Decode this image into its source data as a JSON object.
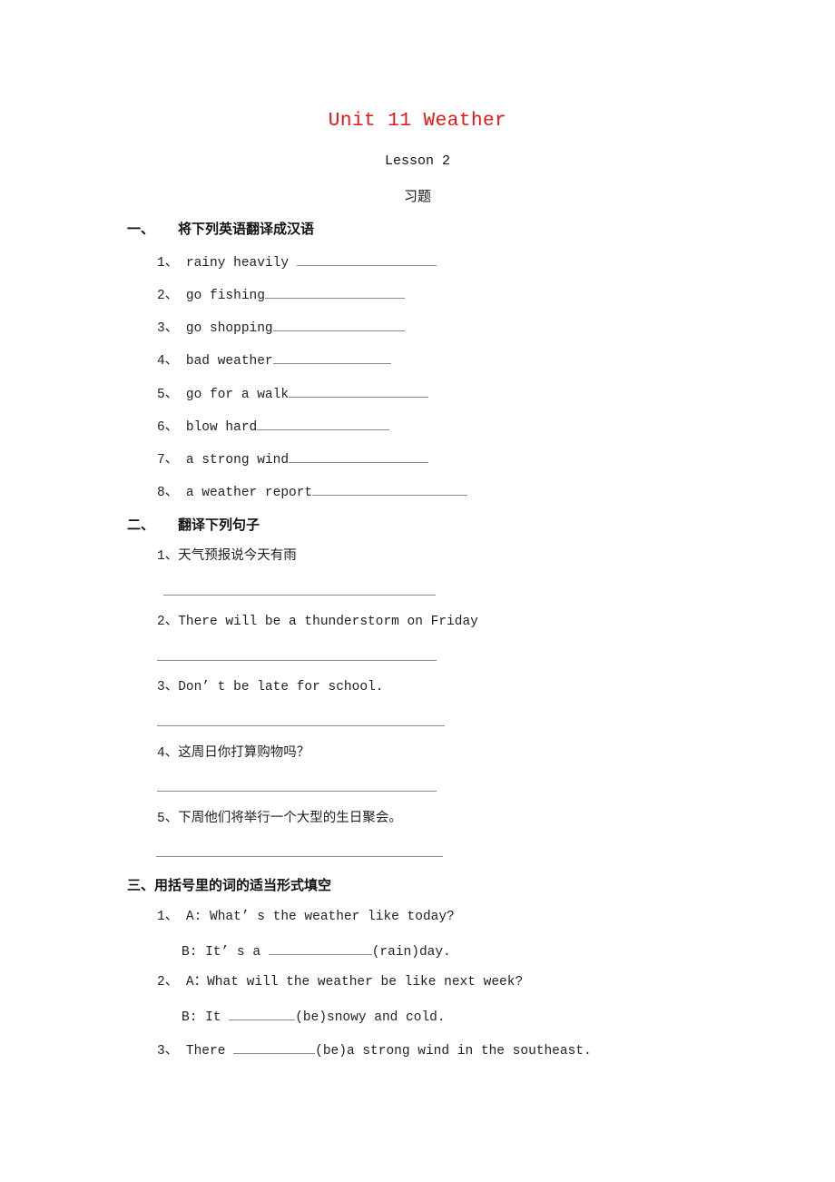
{
  "title": "Unit 11 Weather",
  "lesson": "Lesson 2",
  "exercise_label": "习题",
  "sections": [
    {
      "number": "一、",
      "heading": "将下列英语翻译成汉语",
      "items": [
        {
          "num": "1、",
          "text": "rainy heavily "
        },
        {
          "num": "2、",
          "text": "go fishing"
        },
        {
          "num": "3、",
          "text": "go shopping"
        },
        {
          "num": "4、",
          "text": "bad weather"
        },
        {
          "num": "5、",
          "text": "go for a walk"
        },
        {
          "num": "6、",
          "text": "blow hard"
        },
        {
          "num": "7、",
          "text": "a strong wind"
        },
        {
          "num": "8、",
          "text": "a weather report"
        }
      ]
    },
    {
      "number": "二、",
      "heading": "翻译下列句子",
      "items": [
        {
          "num": "1、",
          "text": "天气预报说今天有雨"
        },
        {
          "num": "2、",
          "text": "There will be a thunderstorm on Friday"
        },
        {
          "num": "3、",
          "text": "Don’ t be late for school."
        },
        {
          "num": "4、",
          "text": "这周日你打算购物吗？"
        },
        {
          "num": "5、",
          "text": "下周他们将举行一个大型的生日聚会。"
        }
      ]
    },
    {
      "number": "三、",
      "heading": "用括号里的词的适当形式填空",
      "items": [
        {
          "num": "1、",
          "a": "A: What’ s the weather like today?",
          "b_pre": "B: It’ s a ",
          "b_hint": "(rain)",
          "b_post": "day."
        },
        {
          "num": "2、",
          "a": "A：What will the weather be like next week?",
          "b_pre": "B: It ",
          "b_hint": "(be)",
          "b_post": "snowy and cold."
        },
        {
          "num": "3、",
          "a_pre": "There ",
          "a_hint": "(be)",
          "a_post": "a strong wind in the southeast."
        }
      ]
    }
  ]
}
